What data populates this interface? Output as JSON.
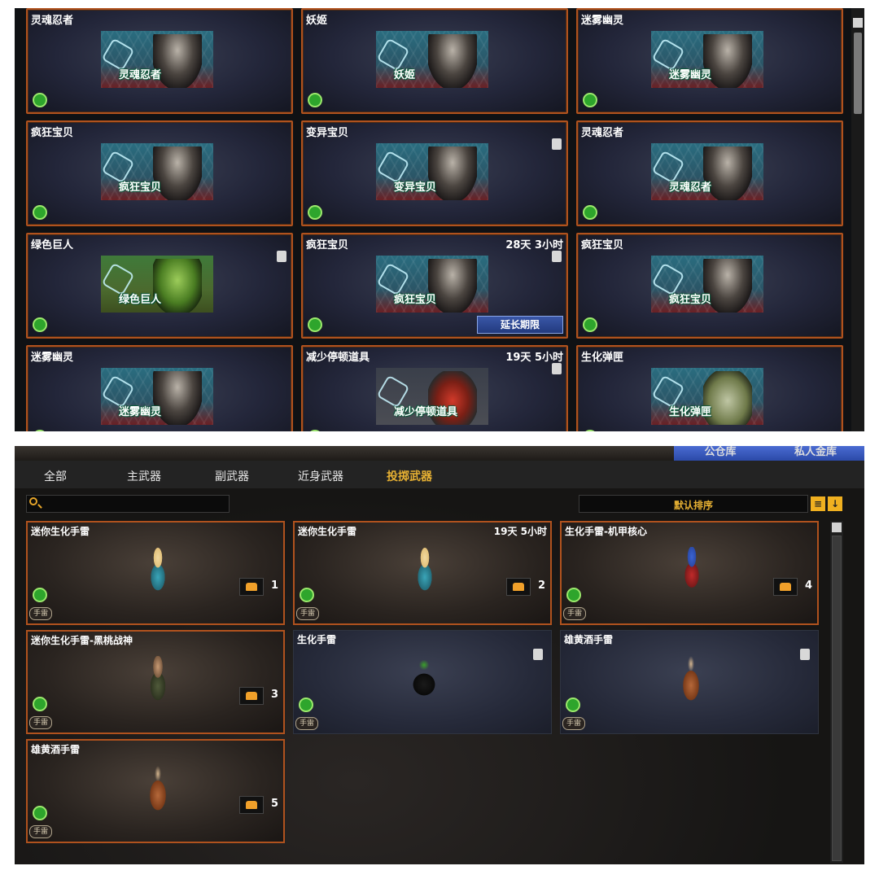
{
  "top_cards": [
    {
      "title": "灵魂忍者",
      "time": "",
      "thumb_label": "灵魂忍者",
      "trash": false,
      "extend": false,
      "kind": "ninja"
    },
    {
      "title": "妖姬",
      "time": "",
      "thumb_label": "妖姬",
      "trash": false,
      "extend": false,
      "kind": "ninja"
    },
    {
      "title": "迷雾幽灵",
      "time": "",
      "thumb_label": "迷雾幽灵",
      "trash": false,
      "extend": false,
      "kind": "ninja"
    },
    {
      "title": "疯狂宝贝",
      "time": "",
      "thumb_label": "疯狂宝贝",
      "trash": false,
      "extend": false,
      "kind": "ninja"
    },
    {
      "title": "变异宝贝",
      "time": "",
      "thumb_label": "变异宝贝",
      "trash": true,
      "extend": false,
      "kind": "ninja"
    },
    {
      "title": "灵魂忍者",
      "time": "",
      "thumb_label": "灵魂忍者",
      "trash": false,
      "extend": false,
      "kind": "ninja"
    },
    {
      "title": "绿色巨人",
      "time": "",
      "thumb_label": "绿色巨人",
      "trash": true,
      "extend": false,
      "kind": "giant"
    },
    {
      "title": "疯狂宝贝",
      "time": "28天 3小时",
      "thumb_label": "疯狂宝贝",
      "trash": true,
      "extend": true,
      "kind": "ninja"
    },
    {
      "title": "疯狂宝贝",
      "time": "",
      "thumb_label": "疯狂宝贝",
      "trash": false,
      "extend": false,
      "kind": "ninja"
    },
    {
      "title": "迷雾幽灵",
      "time": "",
      "thumb_label": "迷雾幽灵",
      "trash": false,
      "extend": false,
      "kind": "ninja"
    },
    {
      "title": "减少停顿道具",
      "time": "19天 5小时",
      "thumb_label": "减少停顿道具",
      "trash": true,
      "extend": false,
      "kind": "reduce"
    },
    {
      "title": "生化弹匣",
      "time": "",
      "thumb_label": "生化弹匣",
      "trash": false,
      "extend": false,
      "kind": "ammo"
    }
  ],
  "extend_label": "延长期限",
  "main_tabs": [
    "公仓库",
    "私人金库"
  ],
  "sub_tabs": [
    {
      "label": "全部",
      "active": false
    },
    {
      "label": "主武器",
      "active": false
    },
    {
      "label": "副武器",
      "active": false
    },
    {
      "label": "近身武器",
      "active": false
    },
    {
      "label": "投掷武器",
      "active": true
    }
  ],
  "search": {
    "placeholder": ""
  },
  "sort": {
    "label": "默认排序"
  },
  "weapon_cards": [
    {
      "title": "迷你生化手雷",
      "time": "",
      "count": "1",
      "tag": "手雷",
      "trash": false,
      "style": "orange",
      "item": "doll"
    },
    {
      "title": "迷你生化手雷",
      "time": "19天 5小时",
      "count": "2",
      "tag": "手雷",
      "trash": false,
      "style": "orange",
      "item": "doll"
    },
    {
      "title": "生化手雷-机甲核心",
      "time": "",
      "count": "4",
      "tag": "手雷",
      "trash": false,
      "style": "orange",
      "item": "robot"
    },
    {
      "title": "迷你生化手雷-黑桃战神",
      "time": "",
      "count": "3",
      "tag": "手雷",
      "trash": false,
      "style": "orange",
      "item": "soldier"
    },
    {
      "title": "生化手雷",
      "time": "",
      "count": "",
      "tag": "手雷",
      "trash": true,
      "style": "plain",
      "item": "grenade"
    },
    {
      "title": "雄黄酒手雷",
      "time": "",
      "count": "",
      "tag": "手雷",
      "trash": true,
      "style": "plain",
      "item": "jar"
    },
    {
      "title": "雄黄酒手雷",
      "time": "",
      "count": "5",
      "tag": "手雷",
      "trash": false,
      "style": "orange",
      "item": "jar"
    }
  ],
  "colors": {
    "accent": "#e7b133",
    "border": "#b0521e",
    "tab_blue": "#3a57a8"
  }
}
